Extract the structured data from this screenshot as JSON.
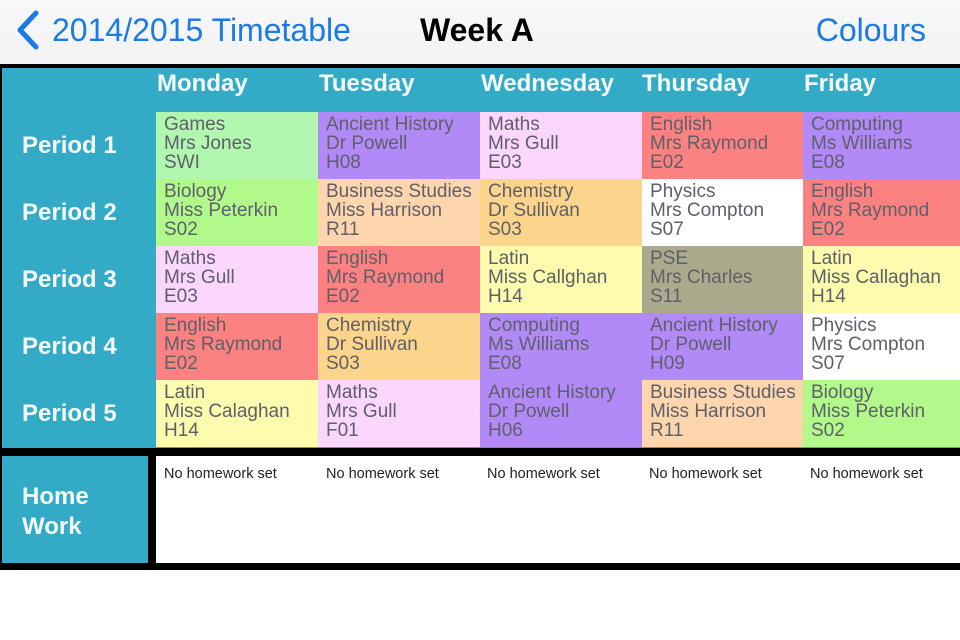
{
  "nav": {
    "back_label": "2014/2015 Timetable",
    "title": "Week A",
    "right_button": "Colours",
    "accent_color": "#1a7ae8"
  },
  "timetable": {
    "header_color": "#33abc7",
    "days": [
      "Monday",
      "Tuesday",
      "Wednesday",
      "Thursday",
      "Friday"
    ],
    "periods": [
      "Period 1",
      "Period 2",
      "Period 3",
      "Period 4",
      "Period 5"
    ],
    "rows": [
      [
        {
          "subject": "Games",
          "teacher": "Mrs Jones",
          "room": "SWI",
          "color": "#b2f7b0"
        },
        {
          "subject": "Ancient History",
          "teacher": "Dr Powell",
          "room": "H08",
          "color": "#b28af7"
        },
        {
          "subject": "Maths",
          "teacher": "Mrs Gull",
          "room": "E03",
          "color": "#fbd6fd"
        },
        {
          "subject": "English",
          "teacher": "Mrs Raymond",
          "room": "E02",
          "color": "#fc8282"
        },
        {
          "subject": "Computing",
          "teacher": "Ms Williams",
          "room": "E08",
          "color": "#b28af7"
        }
      ],
      [
        {
          "subject": "Biology",
          "teacher": "Miss Peterkin",
          "room": "S02",
          "color": "#b1f98a"
        },
        {
          "subject": "Business Studies",
          "teacher": "Miss Harrison",
          "room": "R11",
          "color": "#fdd6ae"
        },
        {
          "subject": "Chemistry",
          "teacher": "Dr Sullivan",
          "room": "S03",
          "color": "#fcd48c"
        },
        {
          "subject": "Physics",
          "teacher": "Mrs Compton",
          "room": "S07",
          "color": "#ffffff"
        },
        {
          "subject": "English",
          "teacher": "Mrs Raymond",
          "room": "E02",
          "color": "#fc8282"
        }
      ],
      [
        {
          "subject": "Maths",
          "teacher": "Mrs Gull",
          "room": "E03",
          "color": "#fbd6fd"
        },
        {
          "subject": "English",
          "teacher": "Mrs Raymond",
          "room": "E02",
          "color": "#fc8282"
        },
        {
          "subject": "Latin",
          "teacher": "Miss Callghan",
          "room": "H14",
          "color": "#fdfcae"
        },
        {
          "subject": "PSE",
          "teacher": "Mrs Charles",
          "room": "S11",
          "color": "#acaa8c"
        },
        {
          "subject": "Latin",
          "teacher": "Miss Callaghan",
          "room": "H14",
          "color": "#fdfcae"
        }
      ],
      [
        {
          "subject": "English",
          "teacher": "Mrs Raymond",
          "room": "E02",
          "color": "#fc8282"
        },
        {
          "subject": "Chemistry",
          "teacher": "Dr Sullivan",
          "room": "S03",
          "color": "#fcd48c"
        },
        {
          "subject": "Computing",
          "teacher": "Ms Williams",
          "room": "E08",
          "color": "#b28af7"
        },
        {
          "subject": "Ancient History",
          "teacher": "Dr Powell",
          "room": "H09",
          "color": "#b28af7"
        },
        {
          "subject": "Physics",
          "teacher": "Mrs Compton",
          "room": "S07",
          "color": "#ffffff"
        }
      ],
      [
        {
          "subject": "Latin",
          "teacher": "Miss Calaghan",
          "room": "H14",
          "color": "#fdfcae"
        },
        {
          "subject": "Maths",
          "teacher": "Mrs Gull",
          "room": "F01",
          "color": "#fbd6fd"
        },
        {
          "subject": "Ancient History",
          "teacher": "Dr Powell",
          "room": "H06",
          "color": "#b28af7"
        },
        {
          "subject": "Business Studies",
          "teacher": "Miss Harrison",
          "room": "R11",
          "color": "#fdd6ae"
        },
        {
          "subject": "Biology",
          "teacher": "Miss Peterkin",
          "room": "S02",
          "color": "#b1f98a"
        }
      ]
    ],
    "homework_label_line1": "Home",
    "homework_label_line2": "Work",
    "homework": [
      "No homework set",
      "No homework set",
      "No homework set",
      "No homework set",
      "No homework set"
    ]
  }
}
